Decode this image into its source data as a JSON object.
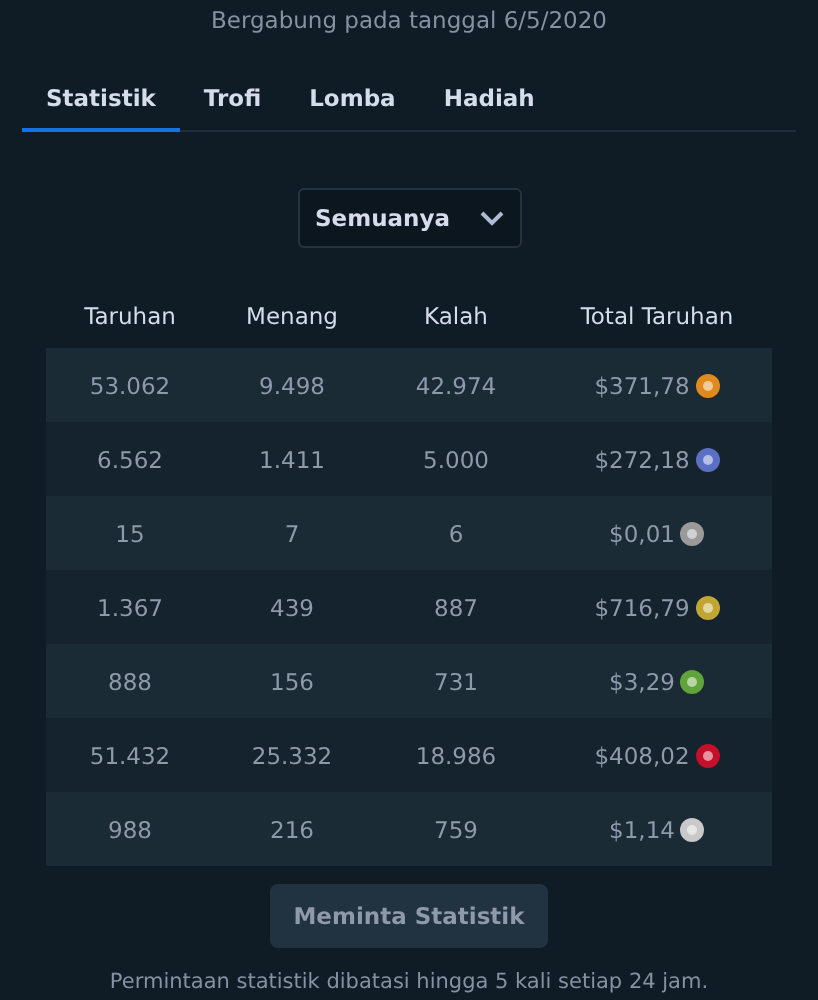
{
  "joined": "Bergabung pada tanggal 6/5/2020",
  "tabs": [
    {
      "label": "Statistik",
      "selected": true
    },
    {
      "label": "Trofi",
      "selected": false
    },
    {
      "label": "Lomba",
      "selected": false
    },
    {
      "label": "Hadiah",
      "selected": false
    }
  ],
  "filter": {
    "value": "Semuanya"
  },
  "table": {
    "columns": [
      "Taruhan",
      "Menang",
      "Kalah",
      "Total Taruhan"
    ],
    "rows": [
      {
        "cells": [
          "53.062",
          "9.498",
          "42.974",
          "$371,78"
        ],
        "color": "#e08a1e"
      },
      {
        "cells": [
          "6.562",
          "1.411",
          "5.000",
          "$272,18"
        ],
        "color": "#5b6fc4"
      },
      {
        "cells": [
          "15",
          "7",
          "6",
          "$0,01"
        ],
        "color": "#9a9a9a"
      },
      {
        "cells": [
          "1.367",
          "439",
          "887",
          "$716,79"
        ],
        "color": "#c2a633"
      },
      {
        "cells": [
          "888",
          "156",
          "731",
          "$3,29"
        ],
        "color": "#5fa33a"
      },
      {
        "cells": [
          "51.432",
          "25.332",
          "18.986",
          "$408,02"
        ],
        "color": "#c5102b"
      },
      {
        "cells": [
          "988",
          "216",
          "759",
          "$1,14"
        ],
        "color": "#c9c9c9"
      }
    ]
  },
  "button": "Meminta Statistik",
  "note": "Permintaan statistik dibatasi hingga 5 kali setiap 24 jam."
}
